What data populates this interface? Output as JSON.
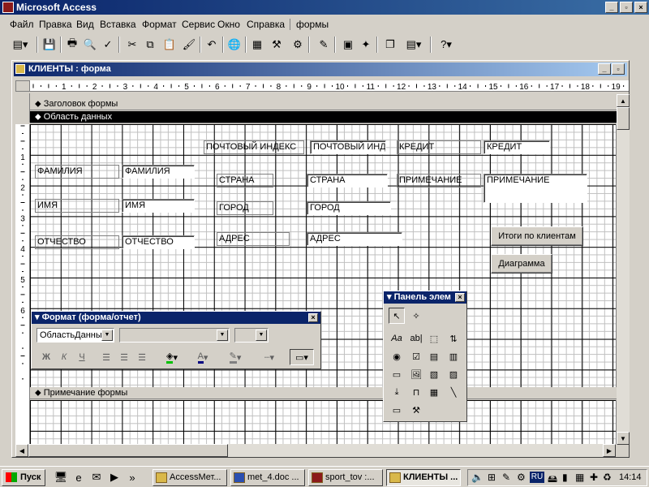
{
  "app": {
    "title": "Microsoft Access"
  },
  "menu": [
    "Файл",
    "Правка",
    "Вид",
    "Вставка",
    "Формат",
    "Сервис",
    "Окно",
    "Справка",
    "формы"
  ],
  "form_window": {
    "title": "КЛИЕНТЫ : форма"
  },
  "ruler": {
    "h_numbers": [
      "1",
      "2",
      "3",
      "4",
      "5",
      "6",
      "7",
      "8",
      "9",
      "10",
      "11",
      "12",
      "13",
      "14",
      "15",
      "16",
      "17",
      "18",
      "19"
    ],
    "v_numbers": [
      "1",
      "2",
      "3",
      "4",
      "5",
      "6"
    ]
  },
  "sections": {
    "header": "Заголовок формы",
    "detail": "Область данных",
    "footer": "Примечание формы"
  },
  "labels": {
    "zip": "ПОЧТОВЫЙ ИНДЕКС",
    "credit": "КРЕДИТ",
    "surname": "ФАМИЛИЯ",
    "country": "СТРАНА",
    "note": "ПРИМЕЧАНИЕ",
    "name": "ИМЯ",
    "city": "ГОРОД",
    "patronymic": "ОТЧЕСТВО",
    "address": "АДРЕС"
  },
  "fields": {
    "zip": "ПОЧТОВЫЙ ИНД",
    "credit": "КРЕДИТ",
    "surname": "ФАМИЛИЯ",
    "country": "СТРАНА",
    "note": "ПРИМЕЧАНИЕ",
    "name": "ИМЯ",
    "city": "ГОРОД",
    "patronymic": "ОТЧЕСТВО",
    "address": "АДРЕС"
  },
  "buttons": {
    "totals": "Итоги по клиентам",
    "chart": "Диаграмма"
  },
  "format_panel": {
    "title": "Формат (форма/отчет)",
    "object_value": "ОбластьДанных",
    "bold": "Ж",
    "italic": "К",
    "underline": "Ч"
  },
  "toolbox": {
    "title": "Панель элем",
    "label_tool": "Aa",
    "textbox_tool": "ab|"
  },
  "taskbar": {
    "start": "Пуск",
    "tasks": [
      "AccessМет...",
      "met_4.doc ...",
      "sport_tov :...",
      "КЛИЕНТЫ ..."
    ],
    "lang": "RU",
    "clock": "14:14"
  },
  "colors": {
    "titlebar": "#0a246a",
    "face": "#d4d0c8",
    "fill_highlight": "#00c000",
    "font_color": "#000080"
  }
}
